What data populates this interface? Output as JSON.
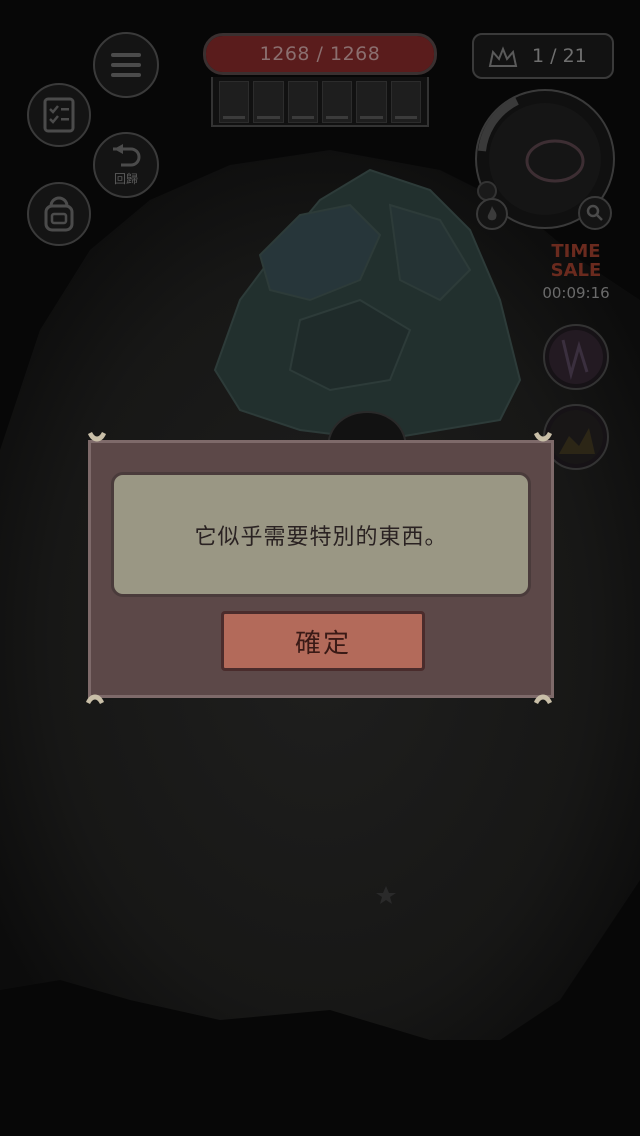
{
  "hud": {
    "hp_text": "1268 / 1268",
    "hp_fraction": 1.0,
    "party_count": 6,
    "counter_text": "1 / 21",
    "return_label": "回歸",
    "time_sale": {
      "title_line1": "TIME",
      "title_line2": "SALE",
      "countdown": "00:09:16"
    }
  },
  "dialog": {
    "message": "它似乎需要特別的東西。",
    "confirm_label": "確定"
  },
  "colors": {
    "dialog_frame": "#5c4848",
    "message_panel": "#9a9784",
    "confirm_button": "#b36a5a",
    "hp_bar": "#5a1c1c"
  },
  "icons": [
    "menu-icon",
    "quest-list-icon",
    "return-icon",
    "backpack-icon",
    "crown-icon",
    "search-icon",
    "flame-icon"
  ]
}
